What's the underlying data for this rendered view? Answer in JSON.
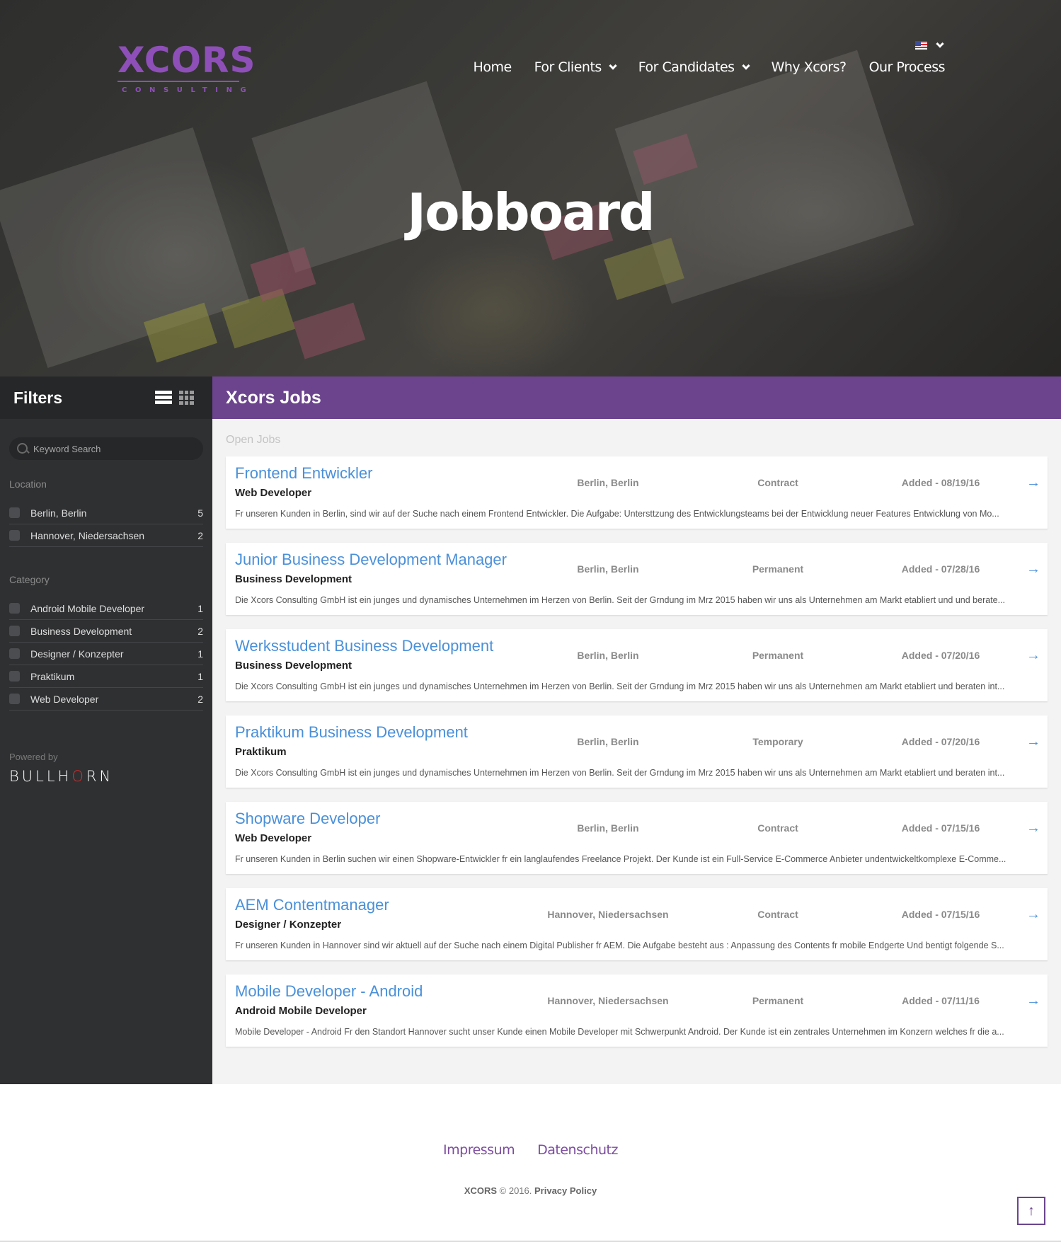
{
  "header": {
    "logo": {
      "word": "XCORS",
      "sub": "CONSULTING"
    },
    "nav": [
      {
        "label": "Home",
        "dropdown": false
      },
      {
        "label": "For Clients",
        "dropdown": true
      },
      {
        "label": "For Candidates",
        "dropdown": true
      },
      {
        "label": "Why Xcors?",
        "dropdown": false
      },
      {
        "label": "Our Process",
        "dropdown": false
      }
    ],
    "language": {
      "icon": "us-flag-icon",
      "selected": "en-US"
    },
    "hero_title": "Jobboard"
  },
  "sidebar": {
    "title": "Filters",
    "view_icons": [
      "list-view-icon",
      "grid-view-icon"
    ],
    "search": {
      "placeholder": "Keyword Search",
      "value": ""
    },
    "location": {
      "title": "Location",
      "items": [
        {
          "label": "Berlin, Berlin",
          "count": "5"
        },
        {
          "label": "Hannover, Niedersachsen",
          "count": "2"
        }
      ]
    },
    "category": {
      "title": "Category",
      "items": [
        {
          "label": "Android Mobile Developer",
          "count": "1"
        },
        {
          "label": "Business Development",
          "count": "2"
        },
        {
          "label": "Designer / Konzepter",
          "count": "1"
        },
        {
          "label": "Praktikum",
          "count": "1"
        },
        {
          "label": "Web Developer",
          "count": "2"
        }
      ]
    },
    "powered_by": "Powered by",
    "brand": {
      "before": "BULLH",
      "accent": "O",
      "after": "RN"
    }
  },
  "content": {
    "title": "Xcors Jobs",
    "subtitle": "Open Jobs",
    "jobs": [
      {
        "title": "Frontend Entwickler",
        "category": "Web Developer",
        "location": "Berlin, Berlin",
        "type": "Contract",
        "added": "Added - 08/19/16",
        "description": "Fr unseren Kunden in Berlin, sind wir auf der Suche nach einem Frontend Entwickler.  Die Aufgabe:   Untersttzung des Entwicklungsteams bei der Entwicklung neuer Features Entwicklung von Mo..."
      },
      {
        "title": "Junior Business Development Manager",
        "category": "Business Development",
        "location": "Berlin, Berlin",
        "type": "Permanent",
        "added": "Added - 07/28/16",
        "description": "Die Xcors Consulting GmbH ist ein junges und dynamisches Unternehmen im Herzen von Berlin. Seit der Grndung im Mrz 2015 haben wir uns als Unternehmen am Markt etabliert und und berate..."
      },
      {
        "title": "Werksstudent Business Development",
        "category": "Business Development",
        "location": "Berlin, Berlin",
        "type": "Permanent",
        "added": "Added - 07/20/16",
        "description": "Die Xcors Consulting GmbH ist ein junges und dynamisches Unternehmen im Herzen von Berlin. Seit der Grndung im Mrz 2015 haben wir uns als Unternehmen am Markt etabliert und beraten int..."
      },
      {
        "title": "Praktikum Business Development",
        "category": "Praktikum",
        "location": "Berlin, Berlin",
        "type": "Temporary",
        "added": "Added - 07/20/16",
        "description": "Die Xcors Consulting GmbH ist ein junges und dynamisches Unternehmen im Herzen von Berlin. Seit der Grndung im Mrz 2015 haben wir uns als Unternehmen am Markt etabliert und beraten int..."
      },
      {
        "title": "Shopware Developer",
        "category": "Web Developer",
        "location": "Berlin, Berlin",
        "type": "Contract",
        "added": "Added - 07/15/16",
        "description": "Fr unseren Kunden in Berlin suchen wir einen Shopware-Entwickler fr ein langlaufendes Freelance Projekt.  Der Kunde ist ein Full-Service E-Commerce Anbieter undentwickeltkomplexe E-Comme..."
      },
      {
        "title": "AEM Contentmanager",
        "category": "Designer / Konzepter",
        "location": "Hannover, Niedersachsen",
        "type": "Contract",
        "added": "Added - 07/15/16",
        "description": "Fr unseren Kunden in Hannover sind wir aktuell auf der Suche nach einem Digital Publisher fr AEM. Die Aufgabe besteht aus : Anpassung des Contents fr mobile Endgerte Und bentigt folgende S..."
      },
      {
        "title": "Mobile Developer - Android",
        "category": "Android Mobile Developer",
        "location": "Hannover, Niedersachsen",
        "type": "Permanent",
        "added": "Added - 07/11/16",
        "description": "Mobile Developer - Android Fr den Standort Hannover sucht unser Kunde einen Mobile Developer mit Schwerpunkt Android. Der Kunde ist ein zentrales Unternehmen im Konzern welches fr die a..."
      }
    ]
  },
  "footer": {
    "links": [
      "Impressum",
      "Datenschutz"
    ],
    "brand": "XCORS",
    "copyright": " © 2016. ",
    "privacy": "Privacy Policy",
    "back_to_top_icon": "arrow-up-icon"
  },
  "colors": {
    "brand_purple": "#6c448e",
    "logo_purple": "#8e4fb8",
    "link_blue": "#4a90d9",
    "sidebar_bg": "#2f3032",
    "bullhorn_red": "#e02b2b"
  }
}
